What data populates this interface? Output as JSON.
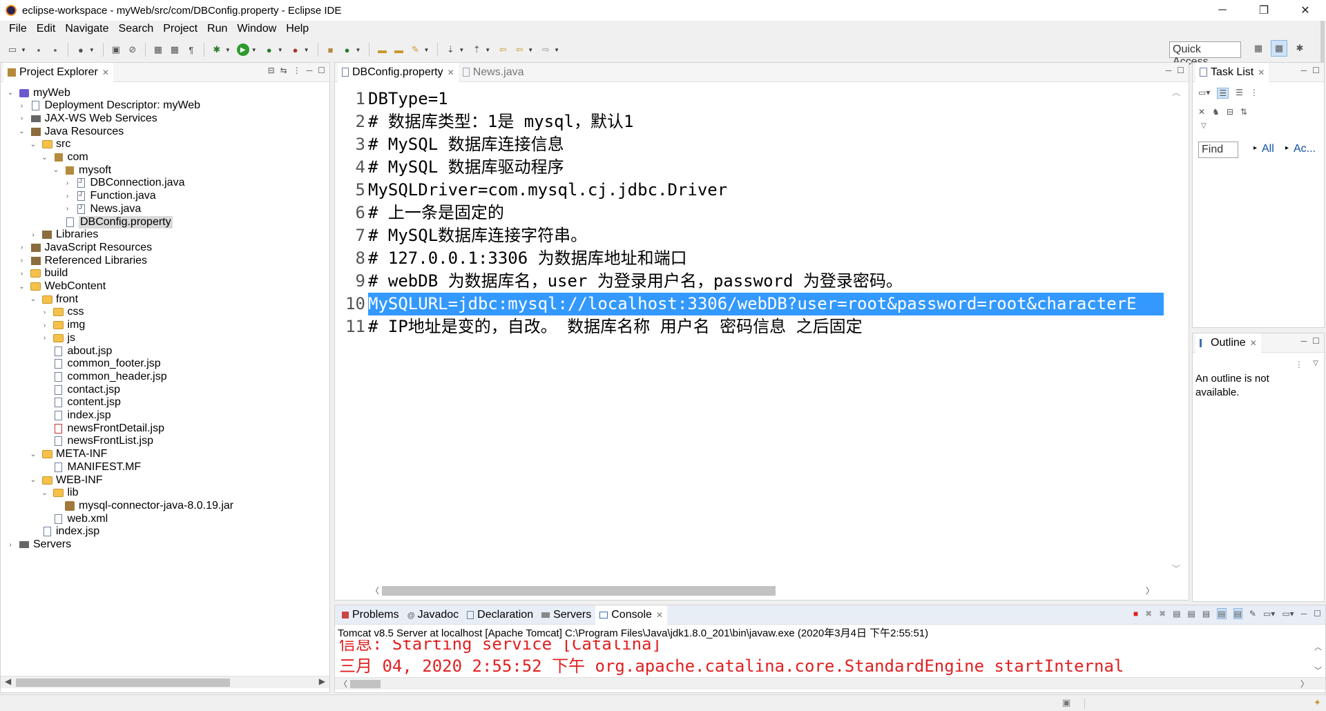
{
  "window": {
    "title": "eclipse-workspace - myWeb/src/com/DBConfig.property - Eclipse IDE",
    "controls": [
      "─",
      "❐",
      "✕"
    ]
  },
  "menu": [
    "File",
    "Edit",
    "Navigate",
    "Search",
    "Project",
    "Run",
    "Window",
    "Help"
  ],
  "toolbar": {
    "quick_access_placeholder": "Quick Access"
  },
  "explorer": {
    "tab_label": "Project Explorer",
    "tree": [
      {
        "label": "myWeb",
        "depth": 0,
        "expanded": true,
        "icon": "project-icon"
      },
      {
        "label": "Deployment Descriptor: myWeb",
        "depth": 1,
        "expanded": false,
        "icon": "descriptor-icon"
      },
      {
        "label": "JAX-WS Web Services",
        "depth": 1,
        "expanded": false,
        "icon": "webservice-icon"
      },
      {
        "label": "Java Resources",
        "depth": 1,
        "expanded": true,
        "icon": "java-resources-icon"
      },
      {
        "label": "src",
        "depth": 2,
        "expanded": true,
        "icon": "source-folder-icon"
      },
      {
        "label": "com",
        "depth": 3,
        "expanded": true,
        "icon": "package-icon"
      },
      {
        "label": "mysoft",
        "depth": 4,
        "expanded": true,
        "icon": "package-icon"
      },
      {
        "label": "DBConnection.java",
        "depth": 5,
        "expanded": false,
        "icon": "java-file-icon"
      },
      {
        "label": "Function.java",
        "depth": 5,
        "expanded": false,
        "icon": "java-file-icon"
      },
      {
        "label": "News.java",
        "depth": 5,
        "expanded": false,
        "icon": "java-file-icon"
      },
      {
        "label": "DBConfig.property",
        "depth": 4,
        "leaf": true,
        "selected": true,
        "icon": "file-icon"
      },
      {
        "label": "Libraries",
        "depth": 2,
        "expanded": false,
        "icon": "library-icon"
      },
      {
        "label": "JavaScript Resources",
        "depth": 1,
        "expanded": false,
        "icon": "js-resources-icon"
      },
      {
        "label": "Referenced Libraries",
        "depth": 1,
        "expanded": false,
        "icon": "library-icon"
      },
      {
        "label": "build",
        "depth": 1,
        "expanded": false,
        "icon": "folder-icon"
      },
      {
        "label": "WebContent",
        "depth": 1,
        "expanded": true,
        "icon": "folder-icon"
      },
      {
        "label": "front",
        "depth": 2,
        "expanded": true,
        "icon": "folder-icon"
      },
      {
        "label": "css",
        "depth": 3,
        "expanded": false,
        "icon": "folder-icon"
      },
      {
        "label": "img",
        "depth": 3,
        "expanded": false,
        "icon": "folder-icon"
      },
      {
        "label": "js",
        "depth": 3,
        "expanded": false,
        "icon": "folder-icon"
      },
      {
        "label": "about.jsp",
        "depth": 3,
        "leaf": true,
        "icon": "jsp-file-icon"
      },
      {
        "label": "common_footer.jsp",
        "depth": 3,
        "leaf": true,
        "icon": "jsp-file-icon"
      },
      {
        "label": "common_header.jsp",
        "depth": 3,
        "leaf": true,
        "icon": "jsp-file-icon"
      },
      {
        "label": "contact.jsp",
        "depth": 3,
        "leaf": true,
        "icon": "jsp-file-icon"
      },
      {
        "label": "content.jsp",
        "depth": 3,
        "leaf": true,
        "icon": "jsp-file-icon"
      },
      {
        "label": "index.jsp",
        "depth": 3,
        "leaf": true,
        "icon": "jsp-file-icon"
      },
      {
        "label": "newsFrontDetail.jsp",
        "depth": 3,
        "leaf": true,
        "icon": "jsp-error-icon"
      },
      {
        "label": "newsFrontList.jsp",
        "depth": 3,
        "leaf": true,
        "icon": "jsp-file-icon"
      },
      {
        "label": "META-INF",
        "depth": 2,
        "expanded": true,
        "icon": "folder-icon"
      },
      {
        "label": "MANIFEST.MF",
        "depth": 3,
        "leaf": true,
        "icon": "file-icon"
      },
      {
        "label": "WEB-INF",
        "depth": 2,
        "expanded": true,
        "icon": "folder-icon"
      },
      {
        "label": "lib",
        "depth": 3,
        "expanded": true,
        "icon": "folder-icon"
      },
      {
        "label": "mysql-connector-java-8.0.19.jar",
        "depth": 4,
        "leaf": true,
        "icon": "jar-icon"
      },
      {
        "label": "web.xml",
        "depth": 3,
        "leaf": true,
        "icon": "xml-file-icon"
      },
      {
        "label": "index.jsp",
        "depth": 2,
        "leaf": true,
        "icon": "jsp-file-icon"
      },
      {
        "label": "Servers",
        "depth": 0,
        "expanded": false,
        "icon": "server-icon"
      }
    ]
  },
  "editor": {
    "tabs": [
      {
        "label": "DBConfig.property",
        "active": true
      },
      {
        "label": "News.java",
        "active": false
      }
    ],
    "lines": [
      {
        "n": "1",
        "text": "DBType=1"
      },
      {
        "n": "2",
        "text": "# 数据库类型：1是 mysql，默认1"
      },
      {
        "n": "3",
        "text": "# MySQL 数据库连接信息"
      },
      {
        "n": "4",
        "text": "# MySQL 数据库驱动程序"
      },
      {
        "n": "5",
        "text": "MySQLDriver=com.mysql.cj.jdbc.Driver"
      },
      {
        "n": "6",
        "text": "# 上一条是固定的"
      },
      {
        "n": "7",
        "text": "# MySQL数据库连接字符串。"
      },
      {
        "n": "8",
        "text": "# 127.0.0.1:3306 为数据库地址和端口"
      },
      {
        "n": "9",
        "text": "# webDB 为数据库名，user 为登录用户名，password 为登录密码。"
      },
      {
        "n": "10",
        "text": "MySQLURL=jdbc:mysql://localhost:3306/webDB?user=root&password=root&characterE",
        "selected": true
      },
      {
        "n": "11",
        "text": "# IP地址是变的，自改。 数据库名称 用户名 密码信息 之后固定"
      }
    ]
  },
  "tasklist": {
    "tab_label": "Task List",
    "find_placeholder": "Find",
    "all_label": "All",
    "activate_label": "Ac..."
  },
  "outline": {
    "tab_label": "Outline",
    "message": "An outline is not available."
  },
  "console": {
    "tabs": [
      {
        "label": "Problems",
        "active": false
      },
      {
        "label": "Javadoc",
        "active": false
      },
      {
        "label": "Declaration",
        "active": false
      },
      {
        "label": "Servers",
        "active": false
      },
      {
        "label": "Console",
        "active": true
      }
    ],
    "info": "Tomcat v8.5 Server at localhost [Apache Tomcat] C:\\Program Files\\Java\\jdk1.8.0_201\\bin\\javaw.exe (2020年3月4日 下午2:55:51)",
    "lines": [
      "信息: Starting service [Catalina]",
      "三月 04, 2020 2:55:52 下午 org.apache.catalina.core.StandardEngine startInternal"
    ]
  },
  "colors": {
    "selection": "#3399ff",
    "console_text": "#e02020"
  }
}
